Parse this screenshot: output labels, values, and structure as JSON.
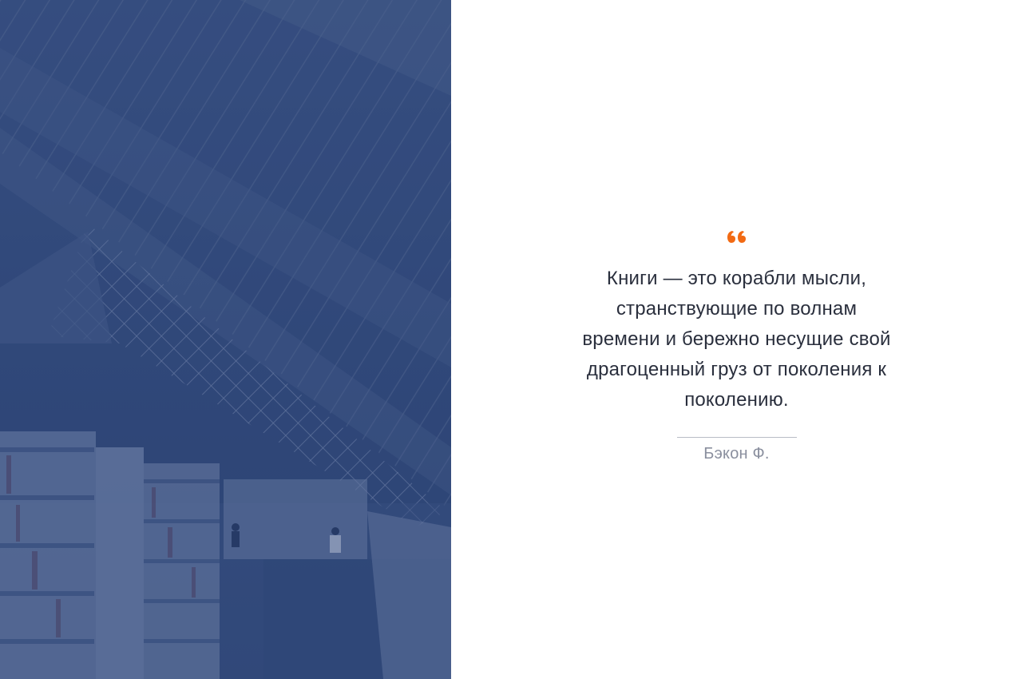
{
  "quote": {
    "text": "Книги — это корабли мысли, странствующие по волнам времени и бережно несущие свой драгоценный груз от поколения к поколению.",
    "author": "Бэкон Ф."
  },
  "colors": {
    "overlay": "#2d4576",
    "quote_mark": "#f26a13",
    "text": "#2a2f3d",
    "author": "#8a8f9e"
  },
  "hero": {
    "icon": "library-photo"
  }
}
